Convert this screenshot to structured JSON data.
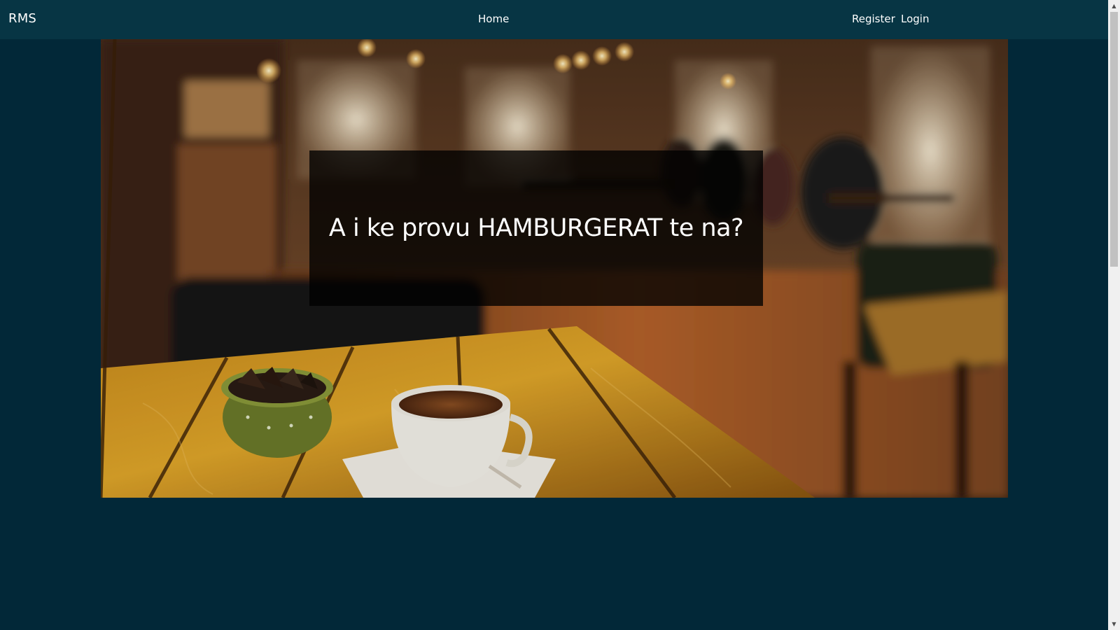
{
  "navbar": {
    "brand": "RMS",
    "links": {
      "home": "Home",
      "register": "Register",
      "login": "Login"
    }
  },
  "hero": {
    "caption": "A i ke provu HAMBURGERAT te na?",
    "image": "cafe-interior-with-coffee-cup-photo"
  },
  "colors": {
    "navbar_bg": "#073544",
    "page_bg": "#022838",
    "caption_bg": "rgba(0,0,0,0.78)"
  }
}
